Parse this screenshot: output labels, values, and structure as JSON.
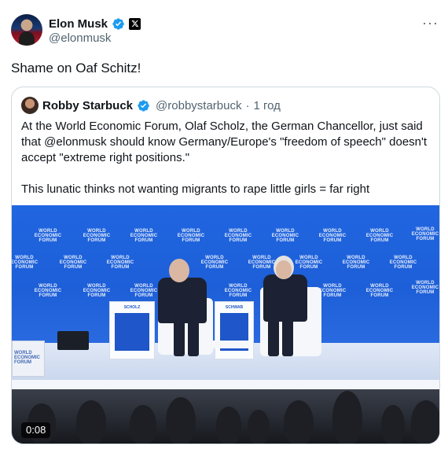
{
  "post": {
    "author": {
      "display_name": "Elon Musk",
      "handle": "@elonmusk"
    },
    "more_label": "···",
    "text": "Shame on Oaf Schitz!"
  },
  "quoted_post": {
    "author": {
      "display_name": "Robby Starbuck",
      "handle": "@robbystarbuck"
    },
    "separator": "·",
    "time": "1 год",
    "paragraph1": "At the World Economic Forum, Olaf Scholz, the German Chancellor, just said that @elonmusk should know Germany/Europe's \"freedom of speech\" doesn't accept \"extreme right positions.\"",
    "paragraph2": "This lunatic thinks not wanting migrants to rape little girls = far right",
    "video": {
      "duration": "0:08",
      "backdrop_text": "WORLD ECONOMIC FORUM",
      "left_screen_text": "WORLD ECONOMIC FORUM",
      "podium_left": "SCHOLZ",
      "podium_right": "SCHWAB"
    }
  },
  "colors": {
    "verified": "#1d9bf0",
    "text_primary": "#0f1419",
    "text_secondary": "#536471",
    "border": "#cfd9de",
    "stage_blue": "#1f5fd8"
  }
}
